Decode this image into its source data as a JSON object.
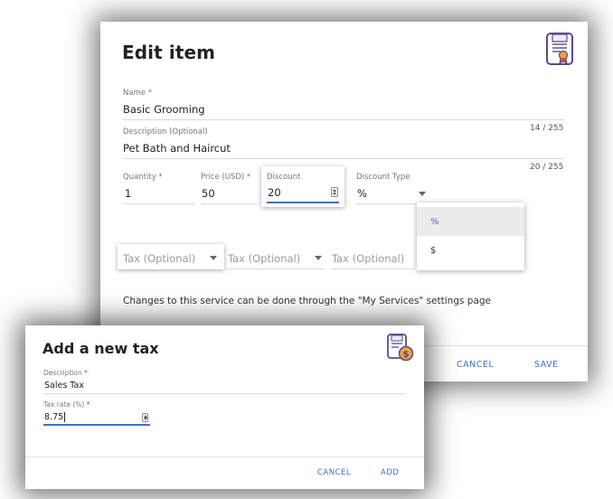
{
  "edit_dialog": {
    "title": "Edit item",
    "name": {
      "label": "Name *",
      "value": "Basic Grooming",
      "counter": "14 / 255"
    },
    "description": {
      "label": "Description (Optional)",
      "value": "Pet Bath and Haircut",
      "counter": "20 / 255"
    },
    "quantity": {
      "label": "Quantity *",
      "value": "1"
    },
    "price": {
      "label": "Price (USD) *",
      "value": "50"
    },
    "discount": {
      "label": "Discount",
      "value": "20"
    },
    "discount_type": {
      "label": "Discount Type",
      "value": "%",
      "options": [
        "%",
        "$"
      ],
      "highlighted_option": "%"
    },
    "tax_placeholders": [
      "Tax (Optional)",
      "Tax (Optional)",
      "Tax (Optional)"
    ],
    "info_text": "Changes to this service can be done through the \"My Services\" settings page",
    "cancel_label": "CANCEL",
    "save_label": "SAVE",
    "icon": "certificate-document-icon"
  },
  "tax_dialog": {
    "title": "Add a new tax",
    "description": {
      "label": "Description",
      "required_mark": "*",
      "value": "Sales Tax"
    },
    "tax_rate": {
      "label": "Tax rate (%)",
      "required_mark": "*",
      "value": "8.75"
    },
    "cancel_label": "CANCEL",
    "add_label": "ADD",
    "icon": "invoice-dollar-icon"
  },
  "colors": {
    "accent": "#3f6fd1",
    "required": "#d33333",
    "icon_purple": "#5a4a8a",
    "icon_orange": "#f0a13a"
  }
}
